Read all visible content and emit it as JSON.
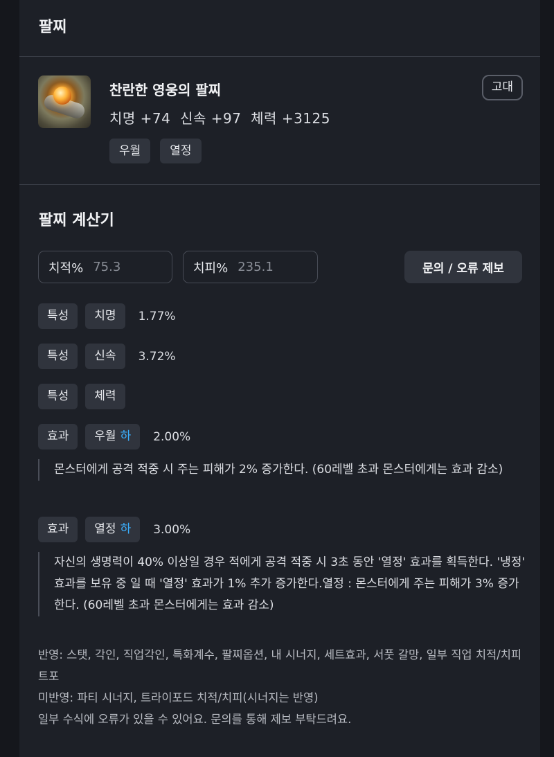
{
  "header": {
    "title": "팔찌"
  },
  "item": {
    "icon": "bracelet-icon",
    "name": "찬란한 영웅의 팔찌",
    "grade": "고대",
    "stats": "치명 +74  신속 +97  체력 +3125",
    "tags": [
      "우월",
      "열정"
    ]
  },
  "calculator": {
    "title": "팔찌 계산기",
    "crit_rate": {
      "label": "치적%",
      "value": "75.3"
    },
    "crit_damage": {
      "label": "치피%",
      "value": "235.1"
    },
    "report_button": "문의 / 오류 제보",
    "rows": [
      {
        "type": "특성",
        "name": "치명",
        "level": "",
        "value": "1.77%"
      },
      {
        "type": "특성",
        "name": "신속",
        "level": "",
        "value": "3.72%"
      },
      {
        "type": "특성",
        "name": "체력",
        "level": "",
        "value": ""
      },
      {
        "type": "효과",
        "name": "우월",
        "level": "하",
        "value": "2.00%"
      },
      {
        "type": "효과",
        "name": "열정",
        "level": "하",
        "value": "3.00%"
      }
    ],
    "descriptions": {
      "superior": "몬스터에게 공격 적중 시 주는 피해가 2% 증가한다. (60레벨 초과 몬스터에게는 효과 감소)",
      "passion": "자신의 생명력이 40% 이상일 경우 적에게 공격 적중 시 3초 동안 '열정' 효과를 획득한다. '냉정' 효과를 보유 중 일 때 '열정' 효과가 1% 추가 증가한다.열정 : 몬스터에게 주는 피해가 3% 증가한다. (60레벨 초과 몬스터에게는 효과 감소)"
    },
    "notes": {
      "reflected": "반영: 스탯, 각인, 직업각인, 특화계수, 팔찌옵션, 내 시너지, 세트효과, 서풋 갈망, 일부 직업 치적/치피 트포",
      "not_reflected": "미반영: 파티 시너지, 트라이포드 치적/치피(시너지는 반영)",
      "disclaimer": "일부 수식에 오류가 있을 수 있어요. 문의를 통해 제보 부탁드려요."
    }
  }
}
